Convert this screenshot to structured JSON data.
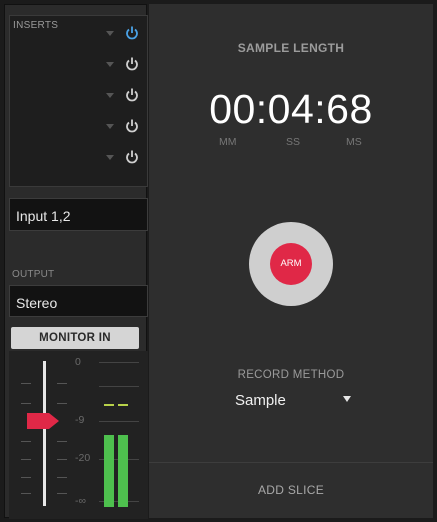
{
  "inserts": {
    "label": "INSERTS",
    "slots": [
      {
        "active": true
      },
      {
        "active": false
      },
      {
        "active": false
      },
      {
        "active": false
      },
      {
        "active": false
      }
    ]
  },
  "input": {
    "value": "Input 1,2"
  },
  "output": {
    "label": "OUTPUT",
    "value": "Stereo"
  },
  "monitor": {
    "label": "MONITOR IN"
  },
  "fader": {
    "scale": [
      "0",
      "-9",
      "-20",
      "-∞"
    ],
    "level_db": -9
  },
  "meter": {
    "left_level": 0.55,
    "right_level": 0.55
  },
  "sample_length": {
    "label": "SAMPLE LENGTH",
    "value": "00:04:68",
    "units": [
      "MM",
      "SS",
      "MS"
    ]
  },
  "arm": {
    "label": "ARM"
  },
  "record_method": {
    "label": "RECORD METHOD",
    "value": "Sample"
  },
  "add_slice": {
    "label": "ADD SLICE"
  },
  "colors": {
    "arm_red": "#e02847",
    "power_active": "#4aa3e8",
    "meter_green": "#4ec04e"
  }
}
